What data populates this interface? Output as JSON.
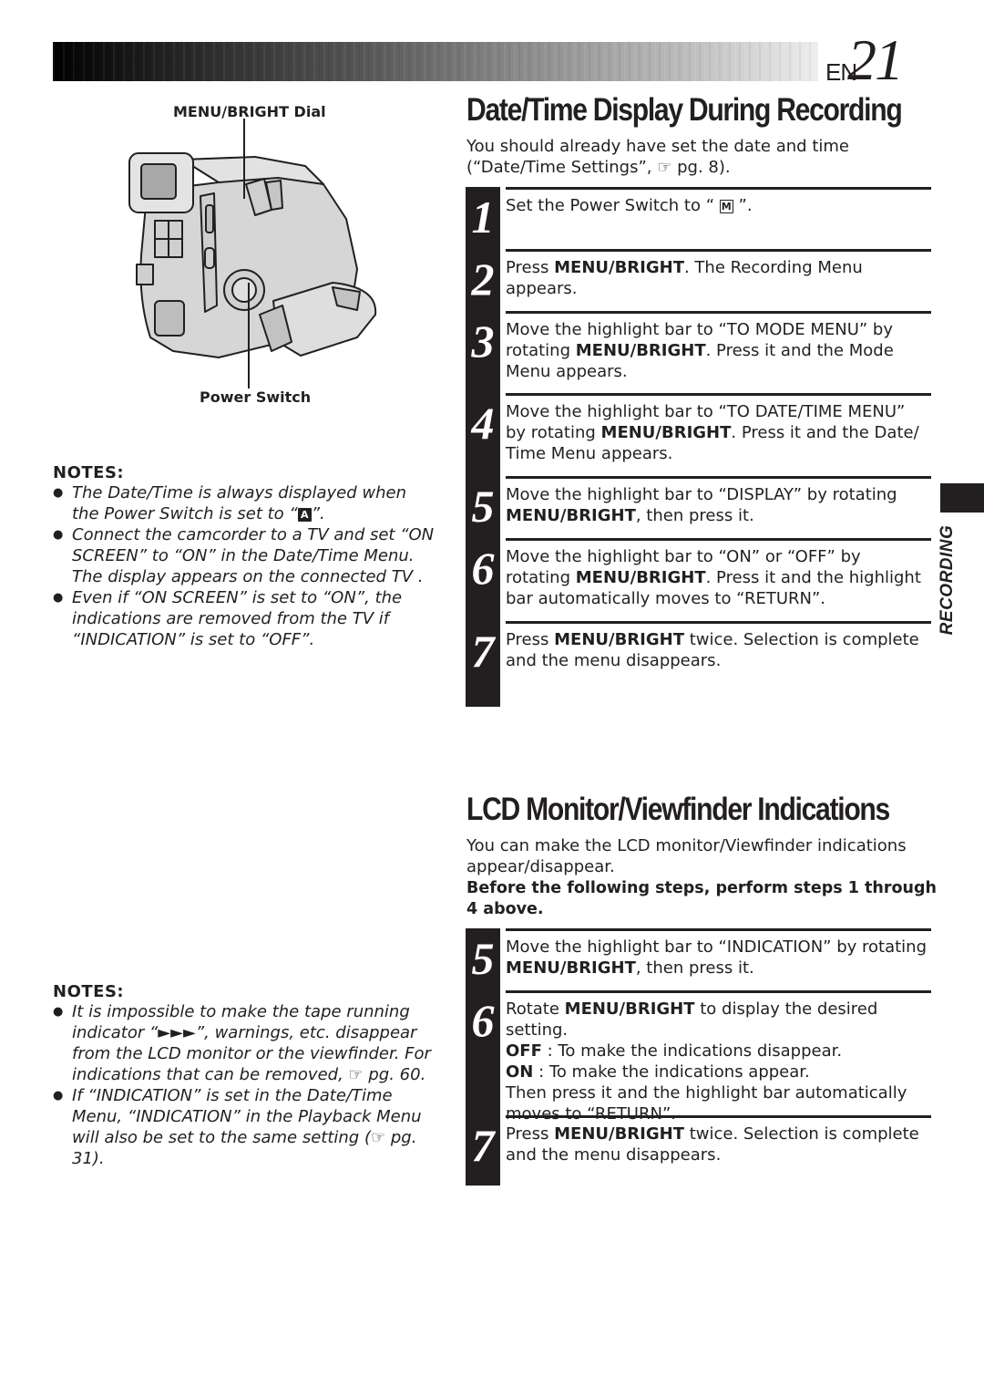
{
  "header": {
    "prefix": "EN",
    "page_number": "21",
    "bar_colors": {
      "start": "#000000",
      "end": "#eeeeee"
    }
  },
  "figure": {
    "label_top": "MENU/BRIGHT Dial",
    "label_bottom": "Power Switch",
    "illustration": "camcorder-illustration"
  },
  "notes_top": {
    "heading": "NOTES:",
    "items": [
      {
        "before": "The Date/Time is always displayed when the Power Switch is set to “",
        "badge": "A",
        "after": "”."
      },
      {
        "text": "Connect the camcorder to a TV and set “ON SCREEN” to “ON” in the Date/Time Menu. The display appears on the connected TV ."
      },
      {
        "text": "Even if “ON SCREEN” is set to “ON”, the indications are removed from the TV if “INDICATION” is set to “OFF”."
      }
    ]
  },
  "notes_bottom": {
    "heading": "NOTES:",
    "items": [
      {
        "text": "It is impossible to make the tape running indicator “►►►”, warnings, etc. disappear from the LCD monitor or the viewfinder. For indications that can be removed, ☞ pg. 60."
      },
      {
        "text": "If “INDICATION” is set in the Date/Time Menu, “INDICATION” in the Playback Menu will also be set to the same setting (☞ pg. 31)."
      }
    ]
  },
  "section1": {
    "title": "Date/Time Display During Recording",
    "intro": "You should already have set the date and time (“Date/Time Settings”, ☞ pg. 8).",
    "steps": [
      {
        "num": "1",
        "parts": [
          [
            "t",
            "Set the Power Switch to “ "
          ],
          [
            "badge",
            "M"
          ],
          [
            "t",
            " ”."
          ]
        ]
      },
      {
        "num": "2",
        "parts": [
          [
            "t",
            "Press "
          ],
          [
            "b",
            "MENU/BRIGHT"
          ],
          [
            "t",
            ". The Recording Menu appears."
          ]
        ]
      },
      {
        "num": "3",
        "parts": [
          [
            "t",
            "Move the highlight bar to “TO MODE MENU” by rotating "
          ],
          [
            "b",
            "MENU/BRIGHT"
          ],
          [
            "t",
            ". Press it and the Mode Menu appears."
          ]
        ]
      },
      {
        "num": "4",
        "parts": [
          [
            "t",
            "Move the highlight bar to “TO DATE/TIME MENU” by rotating "
          ],
          [
            "b",
            "MENU/BRIGHT"
          ],
          [
            "t",
            ". Press it and the Date/ Time Menu appears."
          ]
        ]
      },
      {
        "num": "5",
        "parts": [
          [
            "t",
            "Move the highlight bar to “DISPLAY” by rotating "
          ],
          [
            "b",
            "MENU/BRIGHT"
          ],
          [
            "t",
            ", then press it."
          ]
        ]
      },
      {
        "num": "6",
        "parts": [
          [
            "t",
            "Move the highlight bar to “ON” or “OFF” by rotating "
          ],
          [
            "b",
            "MENU/BRIGHT"
          ],
          [
            "t",
            ". Press it and the highlight bar automatically moves to “RETURN”."
          ]
        ]
      },
      {
        "num": "7",
        "parts": [
          [
            "t",
            "Press "
          ],
          [
            "b",
            "MENU/BRIGHT"
          ],
          [
            "t",
            " twice. Selection is complete and the menu disappears."
          ]
        ]
      }
    ]
  },
  "section2": {
    "title": "LCD Monitor/Viewfinder Indications",
    "intro": "You can make the LCD monitor/Viewfinder indications appear/disappear.",
    "intro_bold": "Before the following steps, perform steps 1 through 4 above.",
    "steps": [
      {
        "num": "5",
        "parts": [
          [
            "t",
            "Move the highlight bar to “INDICATION” by rotating "
          ],
          [
            "b",
            "MENU/BRIGHT"
          ],
          [
            "t",
            ", then press it."
          ]
        ]
      },
      {
        "num": "6",
        "parts": [
          [
            "t",
            "Rotate "
          ],
          [
            "b",
            "MENU/BRIGHT"
          ],
          [
            "t",
            " to display the desired setting."
          ],
          [
            "br",
            ""
          ],
          [
            "b",
            "OFF"
          ],
          [
            "t",
            " : To make the indications disappear."
          ],
          [
            "br",
            ""
          ],
          [
            "b",
            "ON"
          ],
          [
            "t",
            "  : To make the indications appear."
          ],
          [
            "br",
            ""
          ],
          [
            "t",
            "Then press it and the highlight bar automatically moves to “RETURN”."
          ]
        ]
      },
      {
        "num": "7",
        "parts": [
          [
            "t",
            "Press "
          ],
          [
            "b",
            "MENU/BRIGHT"
          ],
          [
            "t",
            " twice. Selection is complete and the menu disappears."
          ]
        ]
      }
    ]
  },
  "side_tab": {
    "label": "RECORDING"
  }
}
